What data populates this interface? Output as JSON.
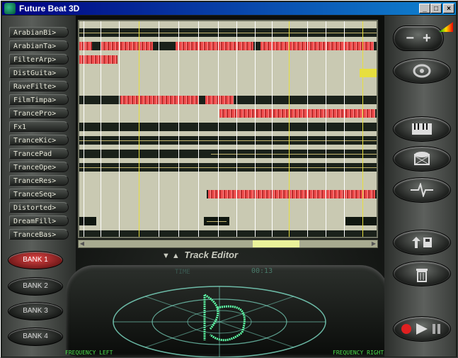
{
  "window": {
    "title": "Future Beat 3D",
    "controls": {
      "minimize": "_",
      "maximize": "□",
      "close": "×"
    }
  },
  "tracks": [
    {
      "name": "ArabianBi>"
    },
    {
      "name": "ArabianTa>"
    },
    {
      "name": "FilterArp>"
    },
    {
      "name": "DistGuita>"
    },
    {
      "name": "RaveFilte>"
    },
    {
      "name": "FilmTimpa>"
    },
    {
      "name": "TrancePro>"
    },
    {
      "name": "Fx1"
    },
    {
      "name": "TranceKic>"
    },
    {
      "name": "TrancePad"
    },
    {
      "name": "TranceOpe>"
    },
    {
      "name": "TranceRes>"
    },
    {
      "name": "TranceSeq>"
    },
    {
      "name": "Distorted>"
    },
    {
      "name": "DreamFill>"
    },
    {
      "name": "TranceBas>"
    }
  ],
  "banks": [
    {
      "label": "BANK 1",
      "active": true
    },
    {
      "label": "BANK 2",
      "active": false
    },
    {
      "label": "BANK 3",
      "active": false
    },
    {
      "label": "BANK 4",
      "active": false
    }
  ],
  "editor": {
    "label": "Track Editor"
  },
  "display": {
    "time_label": "TIME",
    "time_value": "00:13"
  },
  "frequency": {
    "left": "FREQUENCY LEFT",
    "right": "FREQUENCY RIGHT"
  },
  "zoom": {
    "minus": "−",
    "plus": "+"
  },
  "icons": {
    "logo": "future-beat-logo-icon",
    "keyboard": "piano-keyboard-icon",
    "drum": "drum-icon",
    "waveform": "waveform-icon",
    "save_load": "save-load-icon",
    "trash": "trash-icon",
    "transport": "record-play-pause-icon"
  },
  "colors": {
    "clip": "#ee4d4d",
    "grid_background": "#c9c9b2",
    "active_bank": "#d44444"
  }
}
